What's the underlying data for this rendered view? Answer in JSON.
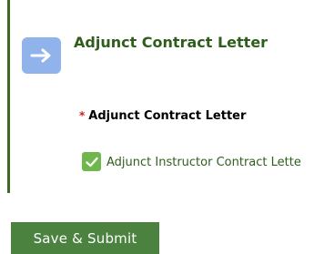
{
  "section": {
    "title": "Adjunct Contract Letter",
    "icon": "arrow-right-icon"
  },
  "field": {
    "required_marker": "*",
    "label": "Adjunct Contract Letter",
    "checkbox_checked": true,
    "checkbox_label": "Adjunct Instructor Contract Lette"
  },
  "actions": {
    "submit_label": "Save & Submit"
  },
  "colors": {
    "accent_green": "#2f5e1c",
    "border_green": "#3e6a27",
    "button_green": "#4c8240",
    "checkbox_green": "#6fb64c",
    "icon_blue": "#8fb3ea",
    "required_red": "#cc1f1f"
  }
}
